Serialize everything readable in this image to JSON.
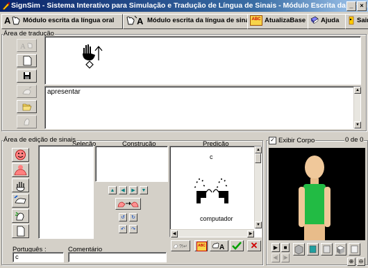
{
  "window": {
    "title": "SignSim - Sistema Interativo para Simulação e Tradução de Língua de Sinais - Módulo Escrita da Língua de Sinais",
    "controls": [
      "_",
      "×"
    ]
  },
  "toolbar": {
    "oral_label": "Módulo escrita da língua oral",
    "signs_label": "Módulo escrita da língua de sinais",
    "abc_badge": "ABC",
    "update_label": "AtualizaBase",
    "help_label": "Ajuda",
    "exit_label": "Sair"
  },
  "translation": {
    "title": "Área de tradução",
    "text": "apresentar"
  },
  "editor": {
    "title": "Área de edição de sinais",
    "selection_label": "Seleção",
    "construction_label": "Construção",
    "prediction_label": "Predição",
    "prediction_top": "c",
    "prediction_word": "computador",
    "portugues_label": "Português :",
    "portugues_value": "c",
    "comentario_label": "Comentário",
    "comentario_value": "",
    "abc_badge": "ABC",
    "x_label": "✕"
  },
  "body_view": {
    "exibir_corpo_label": "Exibir Corpo",
    "exibir_corpo_checked": true,
    "counter": "0 de 0"
  },
  "colors": {
    "title_start": "#0a246a",
    "title_end": "#a6caf0",
    "face": "#d4d0c8",
    "avatar_shirt": "#22bb44",
    "avatar_skin": "#f0c89a",
    "accent_green": "#00a000",
    "accent_red": "#d00000"
  }
}
